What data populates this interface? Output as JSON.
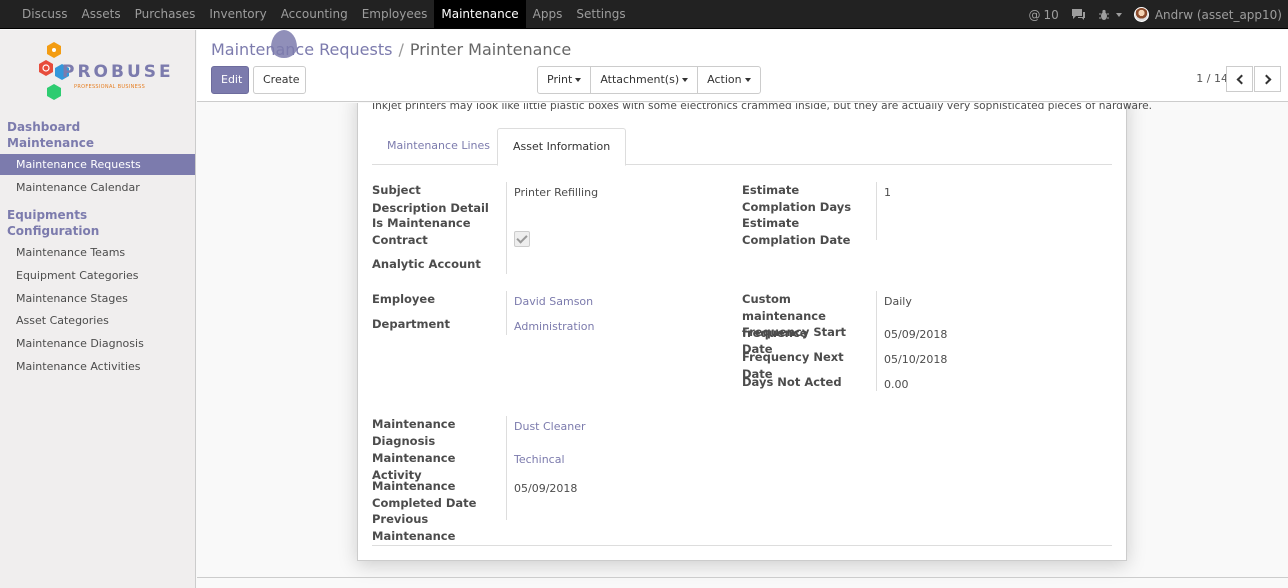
{
  "topbar": {
    "apps": [
      "Discuss",
      "Assets",
      "Purchases",
      "Inventory",
      "Accounting",
      "Employees",
      "Maintenance",
      "Apps",
      "Settings"
    ],
    "active_app": "Maintenance",
    "notification_count": "10",
    "user_name": "Andrw (asset_app10)"
  },
  "logo": {
    "word": "PROBUSE",
    "tagline": "PROFESSIONAL BUSINESS"
  },
  "sidebar": {
    "section1": "Dashboard Maintenance",
    "section1_items": [
      "Maintenance Requests",
      "Maintenance Calendar"
    ],
    "section2": "Equipments Configuration",
    "section2_items": [
      "Maintenance Teams",
      "Equipment Categories",
      "Maintenance Stages",
      "Asset Categories",
      "Maintenance Diagnosis",
      "Maintenance Activities"
    ],
    "active_item": "Maintenance Requests"
  },
  "breadcrumb": {
    "parent": "Maintenance Requests",
    "separator": "/",
    "current": "Printer Maintenance"
  },
  "buttons": {
    "edit": "Edit",
    "create": "Create",
    "print": "Print",
    "attachments": "Attachment(s)",
    "action": "Action"
  },
  "pager": {
    "label": "1 / 14"
  },
  "form": {
    "description": "Inkjet printers may look like little plastic boxes with some electronics crammed inside, but they are actually very sophisticated pieces of hardware.",
    "tabs": [
      "Maintenance Lines",
      "Asset Information"
    ],
    "active_tab": "Asset Information",
    "subject_label": "Subject",
    "subject_value": "Printer Refilling",
    "description_detail_label": "Description Detail",
    "is_contract_label": "Is Maintenance Contract",
    "is_contract_checked": true,
    "analytic_account_label": "Analytic Account",
    "est_days_label": "Estimate Complation Days",
    "est_days_value": "1",
    "est_date_label": "Estimate Complation Date",
    "employee_label": "Employee",
    "employee_value": "David Samson",
    "department_label": "Department",
    "department_value": "Administration",
    "custom_freq_label": "Custom maintenance frequence",
    "custom_freq_value": "Daily",
    "freq_start_label": "Frequency Start Date",
    "freq_start_value": "05/09/2018",
    "freq_next_label": "Frequency Next Date",
    "freq_next_value": "05/10/2018",
    "days_not_acted_label": "Days Not Acted",
    "days_not_acted_value": "0.00",
    "diagnosis_label": "Maintenance Diagnosis",
    "diagnosis_value": "Dust Cleaner",
    "activity_label": "Maintenance Activity",
    "activity_value": "Techincal",
    "completed_label": "Maintenance Completed Date",
    "completed_value": "05/09/2018",
    "previous_label": "Previous Maintenance"
  },
  "colors": {
    "brand": "#7c7bad",
    "topbar": "#222222"
  }
}
